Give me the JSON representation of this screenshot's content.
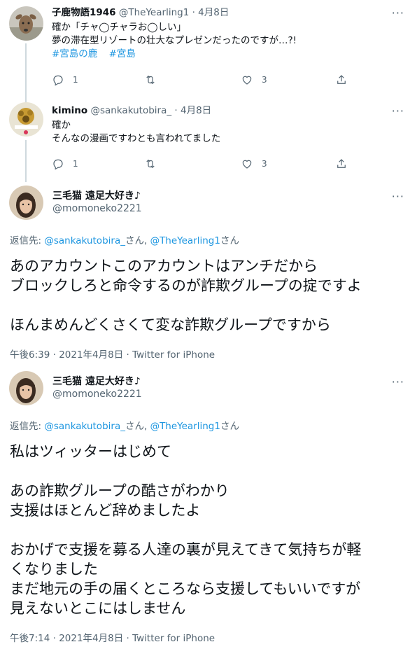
{
  "replies": [
    {
      "name": "子鹿物語1946",
      "handle": "@TheYearling1",
      "separator": "·",
      "date": "4月8日",
      "lines": [
        "確か「チャ◯チャラお◯しい」",
        "夢の滞在型リゾートの壮大なプレゼンだったのですが…?!"
      ],
      "hashtags": [
        "#宮島の鹿",
        "#宮島"
      ],
      "reply_count": "1",
      "like_count": "3"
    },
    {
      "name": "kimino",
      "handle": "@sankakutobira_",
      "separator": "·",
      "date": "4月8日",
      "lines": [
        "確か",
        "そんなの漫画ですわとも言われてました"
      ],
      "reply_count": "1",
      "like_count": "3"
    }
  ],
  "focal_tweets": [
    {
      "name": "三毛猫 遠足大好き♪",
      "handle": "@momoneko2221",
      "replying_prefix": "返信先: ",
      "replying_user1": "@sankakutobira_",
      "replying_sep": "さん, ",
      "replying_user2": "@TheYearling1",
      "replying_suffix": "さん",
      "paragraphs": [
        [
          "あのアカウントこのアカウントはアンチだから",
          "ブロックしろと命令するのが詐欺グループの掟ですよ"
        ],
        [
          "ほんまめんどくさくて変な詐欺グループですから"
        ]
      ],
      "time": "午後6:39",
      "meta_sep": " · ",
      "date": "2021年4月8日",
      "source": "Twitter for iPhone"
    },
    {
      "name": "三毛猫 遠足大好き♪",
      "handle": "@momoneko2221",
      "replying_prefix": "返信先: ",
      "replying_user1": "@sankakutobira_",
      "replying_sep": "さん, ",
      "replying_user2": "@TheYearling1",
      "replying_suffix": "さん",
      "paragraphs": [
        [
          "私はツィッターはじめて"
        ],
        [
          "あの詐欺グループの酷さがわかり",
          "支援はほとんど辞めましたよ"
        ],
        [
          "おかげで支援を募る人達の裏が見えてきて気持ちが軽",
          "くなりました",
          "まだ地元の手の届くところなら支援してもいいですが",
          "見えないとこにはしません"
        ]
      ],
      "time": "午後7:14",
      "meta_sep": " · ",
      "date": "2021年4月8日",
      "source": "Twitter for iPhone"
    }
  ],
  "more_glyph": "···",
  "colors": {
    "link": "#1b95e0",
    "muted": "#536471",
    "text": "#0f1419",
    "thread_line": "#cfd9de"
  }
}
